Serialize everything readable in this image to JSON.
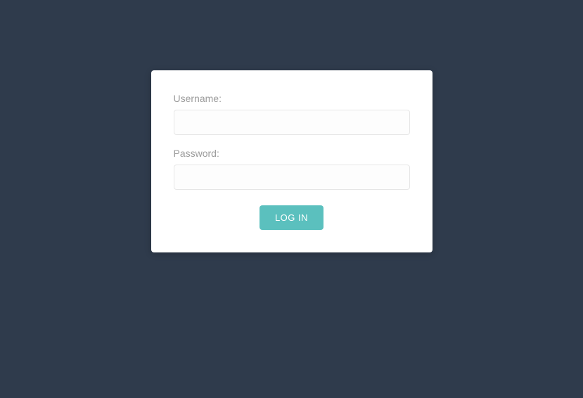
{
  "form": {
    "username_label": "Username:",
    "username_value": "",
    "password_label": "Password:",
    "password_value": "",
    "submit_label": "LOG IN"
  },
  "colors": {
    "background": "#2f3b4c",
    "card": "#ffffff",
    "accent": "#5bc0be",
    "label": "#9b9b9b",
    "input_border": "#e6e6e6"
  }
}
